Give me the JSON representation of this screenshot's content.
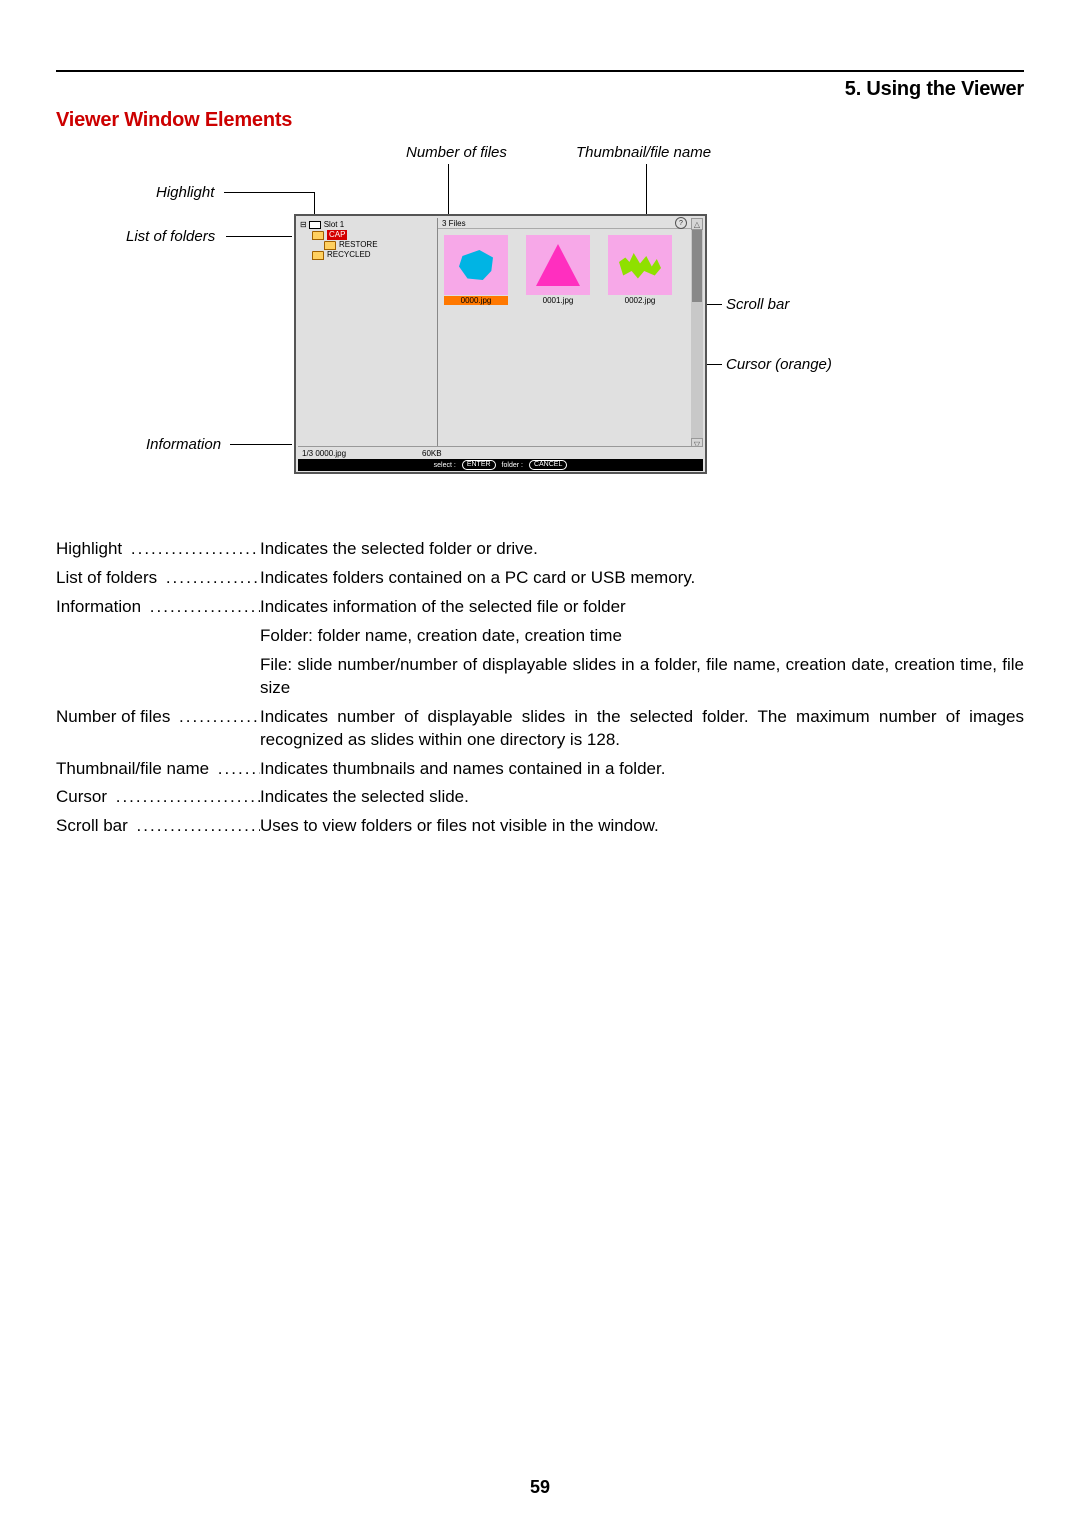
{
  "header": {
    "chapter": "5. Using the Viewer"
  },
  "section": {
    "title": "Viewer Window Elements"
  },
  "callouts": {
    "number_of_files": "Number of files",
    "thumbnail_file_name": "Thumbnail/file name",
    "highlight": "Highlight",
    "list_of_folders": "List of folders",
    "information": "Information",
    "scroll_bar": "Scroll bar",
    "cursor_orange": "Cursor (orange)"
  },
  "viewer": {
    "slot": "Slot 1",
    "folders": {
      "cap": "CAP",
      "restore": "RESTORE",
      "recycled": "RECYCLED"
    },
    "files_count": "3 Files",
    "help": "?",
    "thumbs": [
      {
        "name": "0000.jpg",
        "selected": true
      },
      {
        "name": "0001.jpg",
        "selected": false
      },
      {
        "name": "0002.jpg",
        "selected": false
      }
    ],
    "scroll": {
      "up": "△",
      "down": "▽"
    },
    "info": {
      "line1_left": "1/3  0000.jpg",
      "line1_right": "60KB",
      "hint_select": "select :",
      "hint_enter": "ENTER",
      "hint_folder": "folder :",
      "hint_cancel": "CANCEL"
    }
  },
  "defs": [
    {
      "term": "Highlight",
      "desc": "Indicates the selected folder or drive."
    },
    {
      "term": "List of folders",
      "desc": "Indicates folders contained on a PC card or USB memory."
    },
    {
      "term": "Information",
      "desc": "Indicates information of the selected file or folder"
    },
    {
      "cont": "Folder: folder name, creation date, creation time"
    },
    {
      "cont": "File: slide number/number of displayable slides in a folder, file name, creation date, creation time, file size"
    },
    {
      "term": "Number of files",
      "desc": "Indicates number of displayable slides in the selected folder. The maximum number of images recognized as slides within one directory is 128."
    },
    {
      "term": "Thumbnail/file name",
      "desc": "Indicates thumbnails and names contained in a folder."
    },
    {
      "term": "Cursor",
      "desc": "Indicates the selected slide."
    },
    {
      "term": "Scroll bar",
      "desc": "Uses to view folders or files not visible in the window."
    }
  ],
  "page_number": "59"
}
